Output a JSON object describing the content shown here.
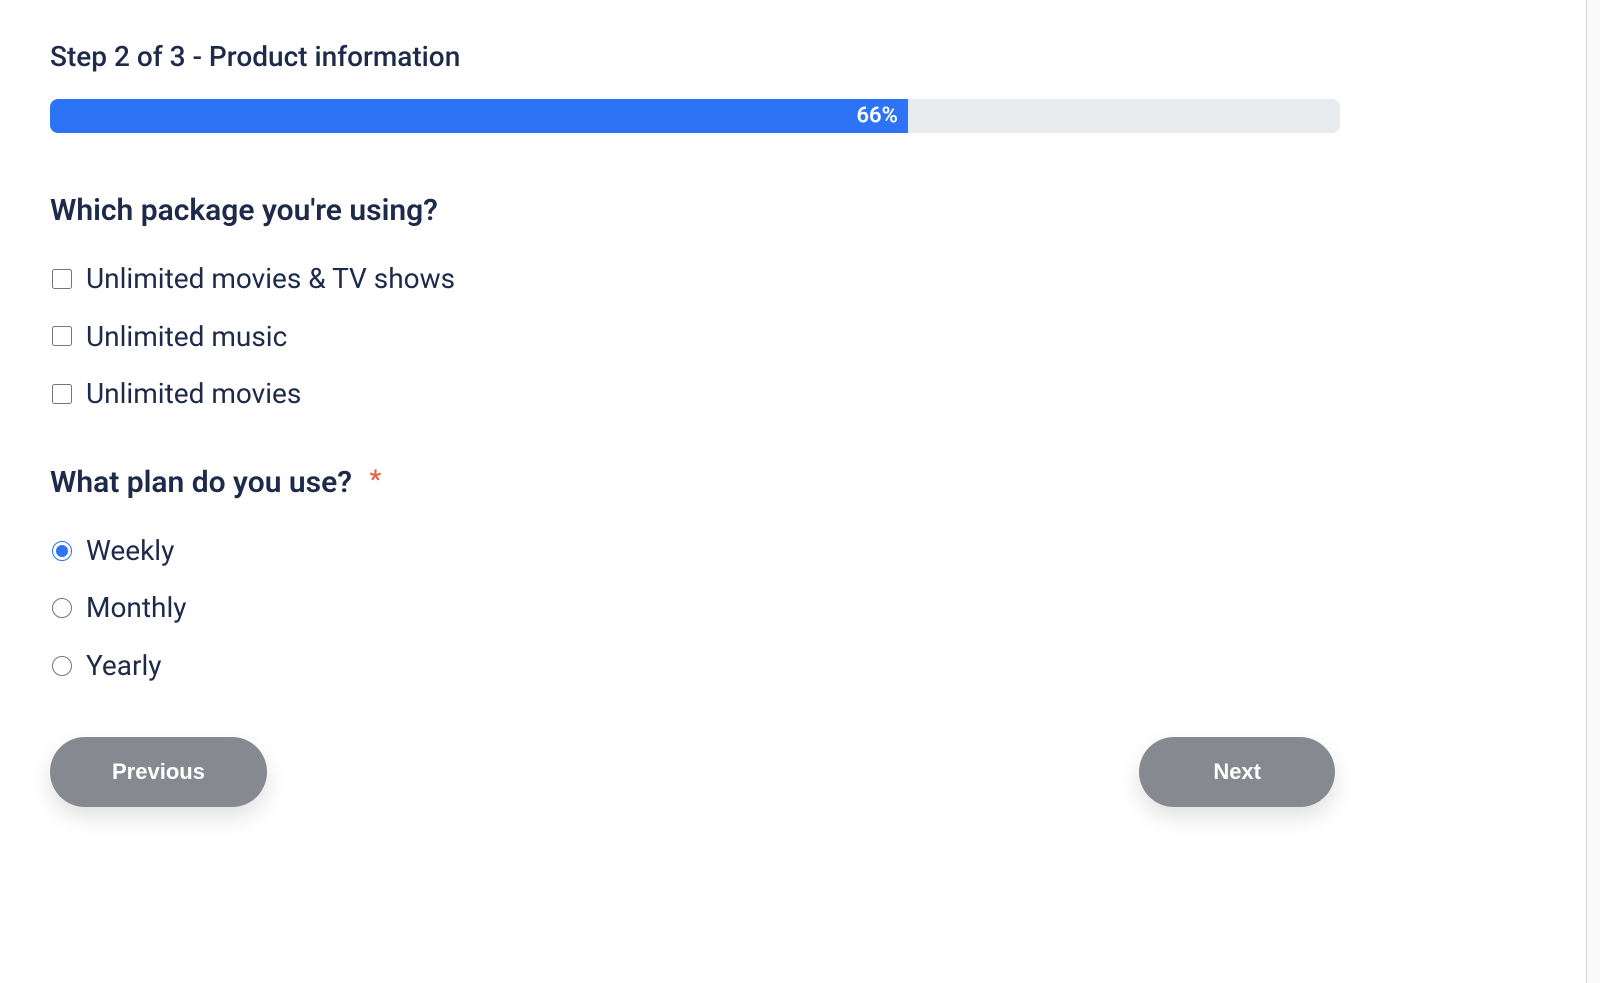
{
  "step": {
    "title": "Step 2 of 3 - Product information"
  },
  "progress": {
    "percent": 66,
    "label": "66%"
  },
  "q1": {
    "prompt": "Which package you're using?",
    "opt1": "Unlimited movies & TV shows",
    "opt2": "Unlimited music",
    "opt3": "Unlimited movies"
  },
  "q2": {
    "prompt": "What plan do you use?",
    "required_mark": "*",
    "opt1": "Weekly",
    "opt2": "Monthly",
    "opt3": "Yearly",
    "selected": "Weekly"
  },
  "buttons": {
    "previous": "Previous",
    "next": "Next"
  }
}
